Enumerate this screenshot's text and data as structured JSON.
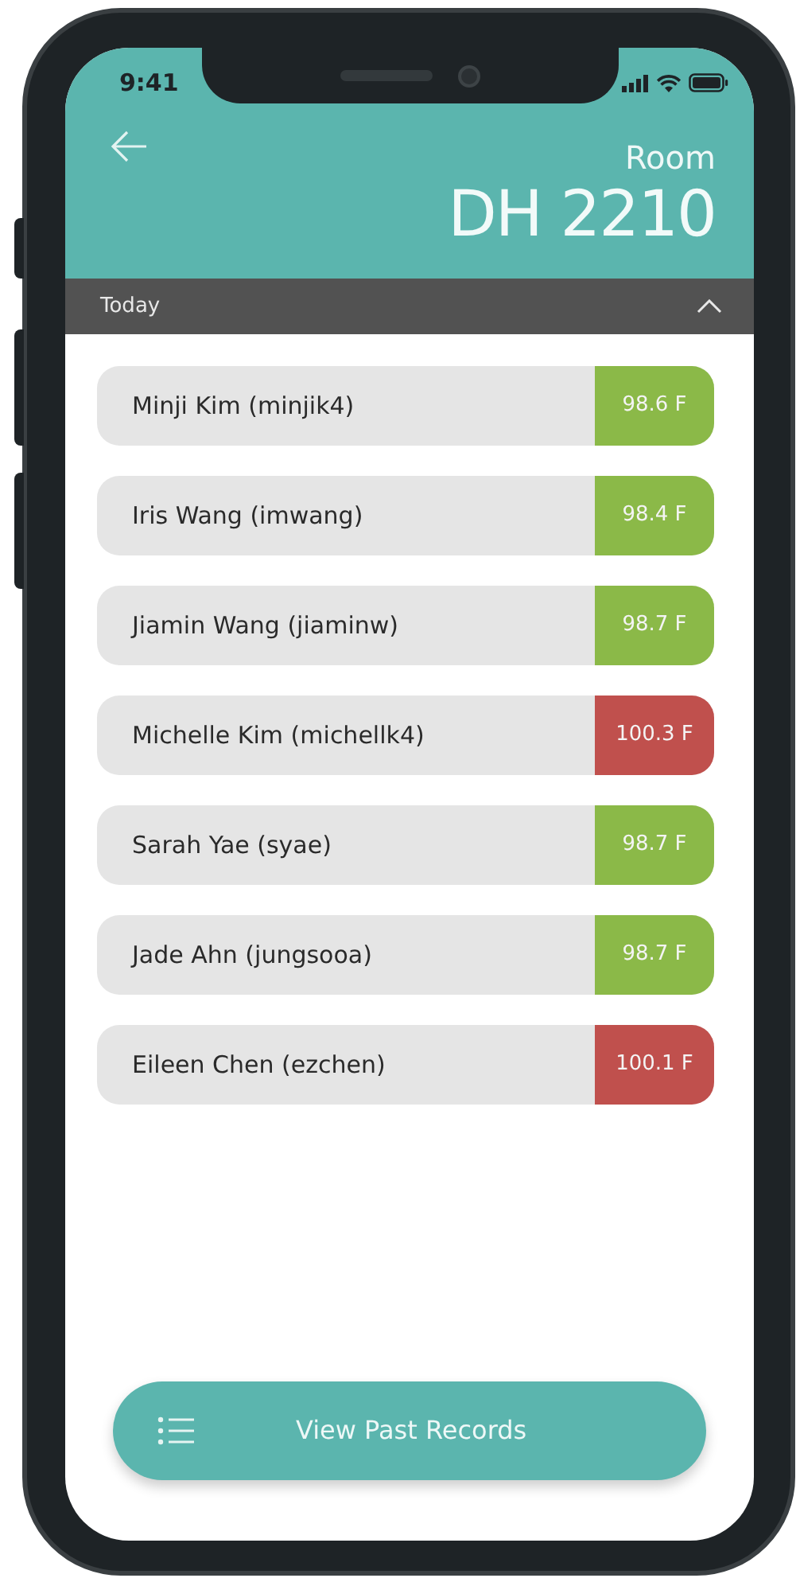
{
  "status_bar": {
    "time": "9:41"
  },
  "header": {
    "label": "Room",
    "room": "DH 2210"
  },
  "section": {
    "title": "Today",
    "expanded": true
  },
  "records": [
    {
      "name": "Minji Kim (minjik4)",
      "temperature": "98.6 F",
      "color": "#8bb948"
    },
    {
      "name": "Iris Wang (imwang)",
      "temperature": "98.4 F",
      "color": "#8bb948"
    },
    {
      "name": "Jiamin Wang (jiaminw)",
      "temperature": "98.7 F",
      "color": "#8bb948"
    },
    {
      "name": "Michelle Kim (michellk4)",
      "temperature": "100.3 F",
      "color": "#c0504d"
    },
    {
      "name": "Sarah Yae (syae)",
      "temperature": "98.7 F",
      "color": "#8bb948"
    },
    {
      "name": "Jade Ahn (jungsooa)",
      "temperature": "98.7 F",
      "color": "#8bb948"
    },
    {
      "name": "Eileen Chen (ezchen)",
      "temperature": "100.1 F",
      "color": "#c0504d"
    }
  ],
  "button": {
    "label": "View Past Records"
  }
}
